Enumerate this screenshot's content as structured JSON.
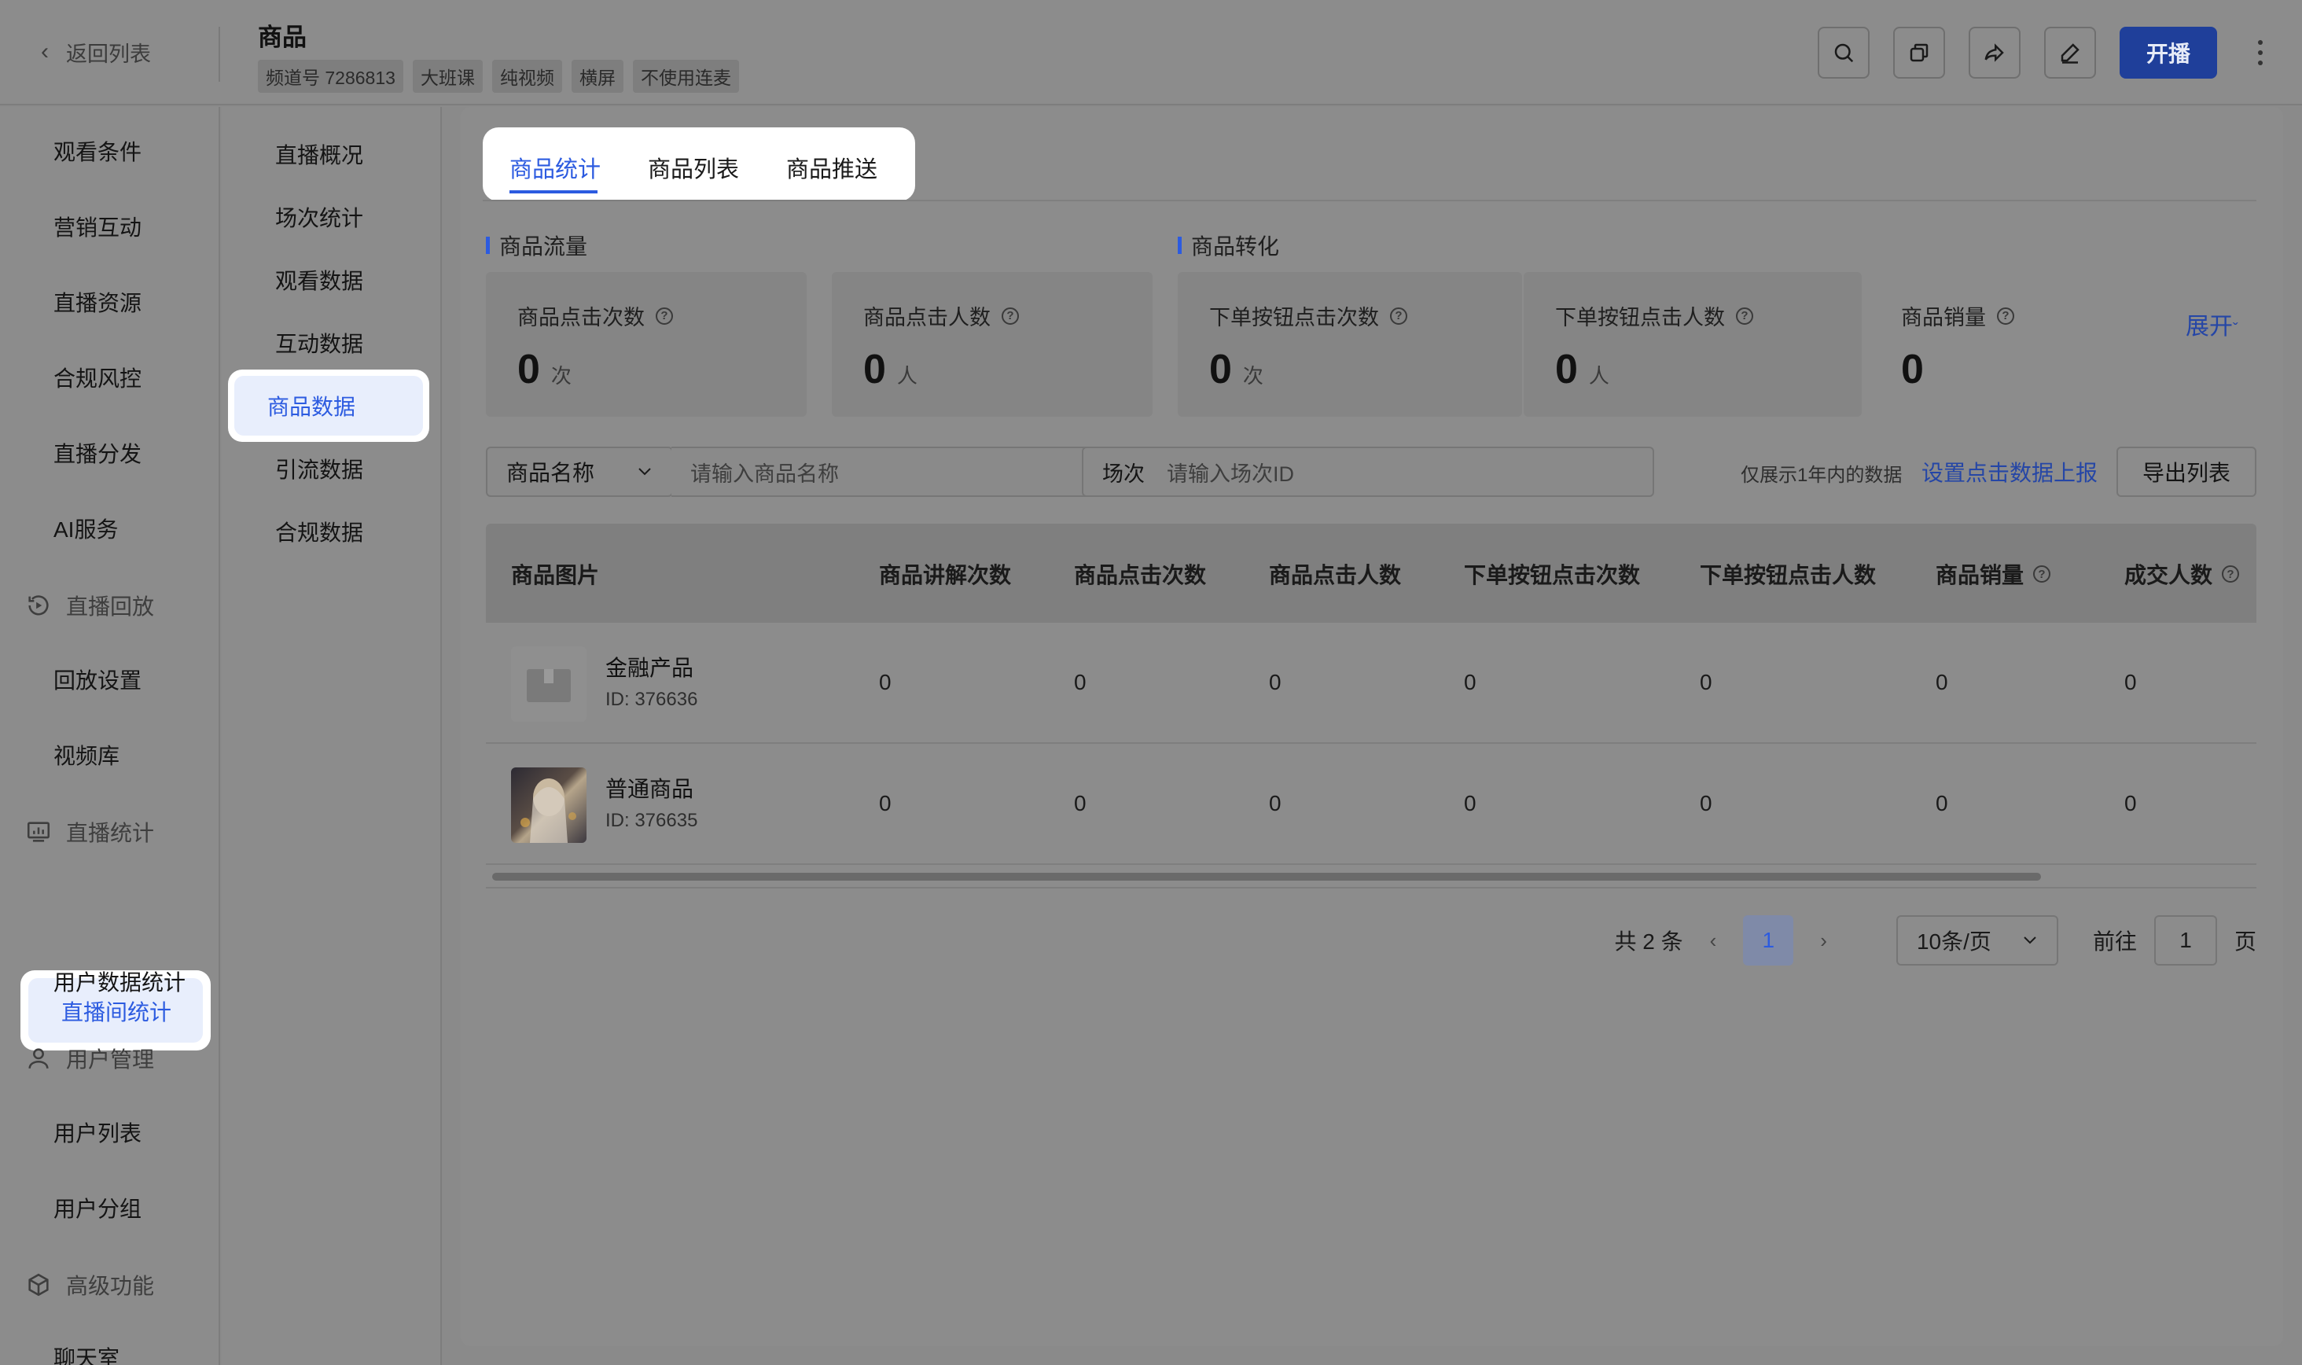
{
  "header": {
    "back_label": "返回列表",
    "title": "商品",
    "tags": [
      "频道号 7286813",
      "大班课",
      "纯视频",
      "横屏",
      "不使用连麦"
    ],
    "toolbar_icons": [
      "search-icon",
      "copy-icon",
      "share-icon",
      "edit-icon"
    ],
    "live_button": "开播",
    "accent_color": "#2c5be0"
  },
  "left_nav": {
    "items": [
      {
        "label": "观看条件",
        "type": "item"
      },
      {
        "label": "营销互动",
        "type": "item"
      },
      {
        "label": "直播资源",
        "type": "item"
      },
      {
        "label": "合规风控",
        "type": "item"
      },
      {
        "label": "直播分发",
        "type": "item"
      },
      {
        "label": "AI服务",
        "type": "item"
      },
      {
        "label": "直播回放",
        "type": "group",
        "icon": "replay-icon"
      },
      {
        "label": "回放设置",
        "type": "item"
      },
      {
        "label": "视频库",
        "type": "item"
      },
      {
        "label": "直播统计",
        "type": "group",
        "icon": "chart-icon"
      },
      {
        "label": "直播间统计",
        "type": "item",
        "active": true
      },
      {
        "label": "用户数据统计",
        "type": "item"
      },
      {
        "label": "用户管理",
        "type": "group",
        "icon": "user-icon"
      },
      {
        "label": "用户列表",
        "type": "item"
      },
      {
        "label": "用户分组",
        "type": "item"
      },
      {
        "label": "高级功能",
        "type": "group",
        "icon": "cube-icon"
      },
      {
        "label": "聊天室",
        "type": "item"
      }
    ]
  },
  "sub_nav": {
    "items": [
      "直播概况",
      "场次统计",
      "观看数据",
      "互动数据",
      "商品数据",
      "引流数据",
      "合规数据"
    ],
    "active": "商品数据"
  },
  "main": {
    "tabs": [
      "商品统计",
      "商品列表",
      "商品推送"
    ],
    "active_tab": "商品统计",
    "section_flow": "商品流量",
    "section_conversion": "商品转化",
    "stats": [
      {
        "label": "商品点击次数",
        "value": "0",
        "unit": "次"
      },
      {
        "label": "商品点击人数",
        "value": "0",
        "unit": "人"
      },
      {
        "label": "下单按钮点击次数",
        "value": "0",
        "unit": "次"
      },
      {
        "label": "下单按钮点击人数",
        "value": "0",
        "unit": "人"
      },
      {
        "label": "商品销量",
        "value": "0",
        "unit": ""
      }
    ],
    "expand_label": "展开",
    "filter": {
      "select_value": "商品名称",
      "name_placeholder": "请输入商品名称",
      "session_label": "场次",
      "session_placeholder": "请输入场次ID"
    },
    "hint": "仅展示1年内的数据",
    "report_link": "设置点击数据上报",
    "export_button": "导出列表",
    "table": {
      "columns": [
        "商品图片",
        "商品讲解次数",
        "商品点击次数",
        "商品点击人数",
        "下单按钮点击次数",
        "下单按钮点击人数",
        "商品销量",
        "成交人数"
      ],
      "rows": [
        {
          "name": "金融产品",
          "id": "ID: 376636",
          "values": [
            "0",
            "0",
            "0",
            "0",
            "0",
            "0",
            "0"
          ]
        },
        {
          "name": "普通商品",
          "id": "ID: 376635",
          "values": [
            "0",
            "0",
            "0",
            "0",
            "0",
            "0",
            "0"
          ]
        }
      ]
    },
    "pagination": {
      "total": "共 2 条",
      "current_page": "1",
      "page_size": "10条/页",
      "goto_label": "前往",
      "goto_value": "1",
      "page_suffix": "页"
    }
  }
}
